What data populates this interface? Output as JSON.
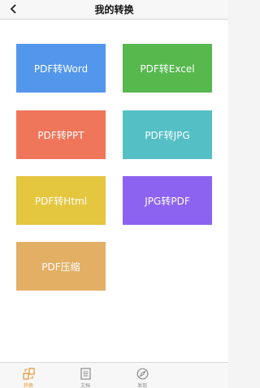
{
  "nav": {
    "title": "我的转换",
    "back_icon": "chevron-left-icon"
  },
  "tiles": [
    {
      "label": "PDF转Word",
      "color": "#5397ec"
    },
    {
      "label": "PDF转Excel",
      "color": "#56b84d"
    },
    {
      "label": "PDF转PPT",
      "color": "#ef765a"
    },
    {
      "label": "PDF转JPG",
      "color": "#55bfc6"
    },
    {
      "label": "PDF转Html",
      "color": "#e4c63f"
    },
    {
      "label": "JPG转PDF",
      "color": "#8c63f0"
    },
    {
      "label": "PDF压缩",
      "color": "#e3af64"
    }
  ],
  "tabs": [
    {
      "label": "转换",
      "icon": "convert-icon",
      "active": true
    },
    {
      "label": "文档",
      "icon": "document-icon",
      "active": false
    },
    {
      "label": "发现",
      "icon": "compass-icon",
      "active": false
    }
  ],
  "colors": {
    "accent": "#e89a3c",
    "inactive": "#8a8a8a"
  }
}
